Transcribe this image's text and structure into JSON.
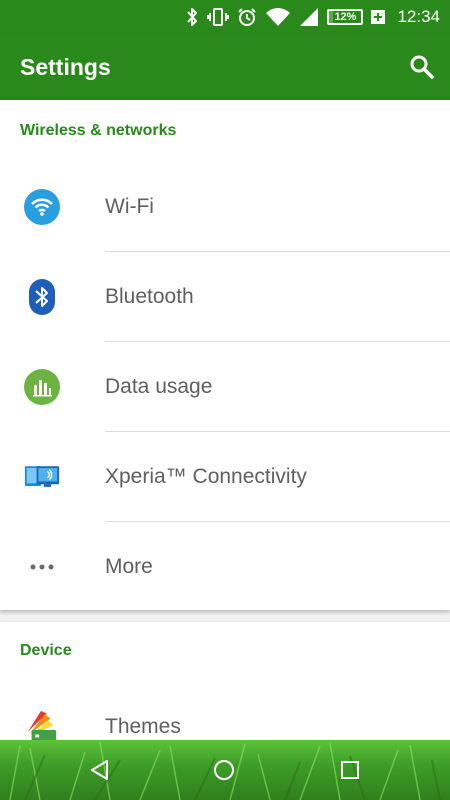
{
  "status_bar": {
    "battery_percent": "12%",
    "battery_level": 0.12,
    "time": "12:34",
    "icons": [
      "bluetooth-icon",
      "vibrate-icon",
      "alarm-icon",
      "wifi-signal-icon",
      "cell-signal-icon",
      "battery-icon",
      "charging-plus-icon"
    ]
  },
  "app_bar": {
    "title": "Settings",
    "search_icon": "search-icon"
  },
  "sections": {
    "wireless": {
      "header": "Wireless & networks",
      "items": [
        {
          "label": "Wi-Fi",
          "icon": "wifi-icon"
        },
        {
          "label": "Bluetooth",
          "icon": "bluetooth-icon"
        },
        {
          "label": "Data usage",
          "icon": "data-usage-icon"
        },
        {
          "label": "Xperia™ Connectivity",
          "icon": "xperia-connectivity-icon"
        },
        {
          "label": "More",
          "icon": "more-dots-icon"
        }
      ]
    },
    "device": {
      "header": "Device",
      "items": [
        {
          "label": "Themes",
          "icon": "themes-icon"
        }
      ]
    }
  },
  "nav_bar": {
    "buttons": [
      "back-icon",
      "home-icon",
      "recents-icon"
    ]
  },
  "colors": {
    "primary": "#298a1b",
    "section_header": "#298a1b",
    "label_text": "#5f5f5f",
    "wifi_blue": "#2a9fe0",
    "bluetooth_blue": "#1f5fb8",
    "data_green": "#6db33f"
  }
}
